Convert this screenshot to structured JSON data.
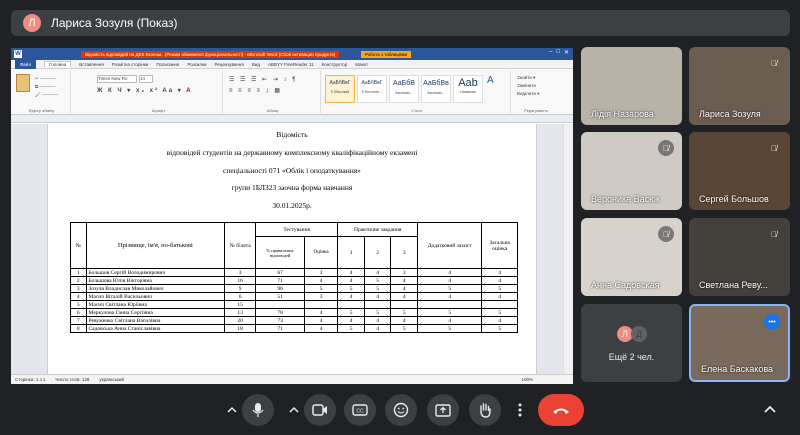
{
  "pinned": {
    "avatar_letter": "Л",
    "title": "Лариса Зозуля (Показ)"
  },
  "word": {
    "title": "Відомість відповідей на ДЕК Економ...(Режим обмеженої функціональності) - Microsoft Word (Сбой активации продукта)",
    "context_tab": "Робота з таблицями",
    "tabs": [
      "Файл",
      "Головна",
      "Вставлення",
      "Розмітка сторінки",
      "Посилання",
      "Розсилки",
      "Рецензування",
      "Вид",
      "ABBYY FineReader 11",
      "Конструктор",
      "Макет"
    ],
    "font_name": "Times New Ro",
    "font_size": "14",
    "styles": [
      {
        "preview": "АаБбВвГ",
        "name": "¶ Обычный"
      },
      {
        "preview": "АаБбВвГ",
        "name": "¶ Без инте..."
      },
      {
        "preview": "АаБбВ",
        "name": "Заголово..."
      },
      {
        "preview": "АаБбВв",
        "name": "Заголово..."
      },
      {
        "preview": "Aab",
        "name": "Название"
      }
    ],
    "group_labels": [
      "Буфер обміну",
      "Шрифт",
      "Абзац",
      "Стилі",
      "Редагування"
    ],
    "edit_items": [
      "Знайти ▾",
      "Замінити",
      "Виділити ▾"
    ],
    "status_left": "Сторінка: 1 з 1",
    "status_words": "Число слов: 128",
    "status_lang": "український",
    "zoom": "100%"
  },
  "doc": {
    "heading": "Відомість",
    "line2": "відповідей студентів на державному комплексному кваліфікаційному екзамені",
    "line3": "спеціальності 071 «Облік і оподаткування»",
    "line4": "групи 1БЛЗ23 заочна форма навчання",
    "line5": "30.01.2025р.",
    "table_headers": {
      "num": "№",
      "name": "Прізвище, ім'я, по-батькові",
      "ticket": "№ білета",
      "testing": "Тестування",
      "pct": "% правильних відповідей",
      "grade": "Оцінка",
      "practical": "Практичне завдання",
      "p1": "1",
      "p2": "2",
      "p3": "3",
      "extra": "Додатковий захист",
      "overall": "Загальна оцінка"
    },
    "rows": [
      {
        "n": "1",
        "name": "Большов Сергій Володимирович",
        "ticket": "3",
        "pct": "67",
        "grade": "3",
        "p1": "4",
        "p2": "4",
        "p3": "3",
        "extra": "4",
        "overall": "4"
      },
      {
        "n": "2",
        "name": "Большова Юлія Вікторівна",
        "ticket": "16",
        "pct": "71",
        "grade": "4",
        "p1": "4",
        "p2": "5",
        "p3": "4",
        "extra": "4",
        "overall": "4"
      },
      {
        "n": "3",
        "name": "Зозуля Владислав Миколайович",
        "ticket": "9",
        "pct": "96",
        "grade": "5",
        "p1": "5",
        "p2": "5",
        "p3": "4",
        "extra": "5",
        "overall": "5"
      },
      {
        "n": "4",
        "name": "Масич Віталій Васильович",
        "ticket": "6",
        "pct": "51",
        "grade": "3",
        "p1": "4",
        "p2": "4",
        "p3": "4",
        "extra": "4",
        "overall": "4"
      },
      {
        "n": "5",
        "name": "Масич Світлана Юріївна",
        "ticket": "15",
        "pct": "",
        "grade": "",
        "p1": "",
        "p2": "",
        "p3": "",
        "extra": "",
        "overall": ""
      },
      {
        "n": "6",
        "name": "Меркулова Ганна Сергіївна",
        "ticket": "13",
        "pct": "78",
        "grade": "4",
        "p1": "5",
        "p2": "5",
        "p3": "5",
        "extra": "5",
        "overall": "5"
      },
      {
        "n": "7",
        "name": "Ревуженко Світлана Василівна",
        "ticket": "20",
        "pct": "73",
        "grade": "4",
        "p1": "4",
        "p2": "4",
        "p3": "4",
        "extra": "4",
        "overall": "4"
      },
      {
        "n": "8",
        "name": "Садовська Анна Станіславівна",
        "ticket": "18",
        "pct": "71",
        "grade": "4",
        "p1": "5",
        "p2": "4",
        "p3": "5",
        "extra": "5",
        "overall": "5"
      }
    ]
  },
  "participants": [
    {
      "name": "Лідія Назарова",
      "muted": false,
      "bg": "#b9b2a8"
    },
    {
      "name": "Лариса Зозуля",
      "muted": true,
      "bg": "#6b5d4f"
    },
    {
      "name": "Вероника Васюк",
      "muted": true,
      "bg": "#cfcac4"
    },
    {
      "name": "Сергей Большов",
      "muted": true,
      "bg": "#5a4636"
    },
    {
      "name": "Анна Садовская",
      "muted": true,
      "bg": "#d7d2cc"
    },
    {
      "name": "Светлана Реву...",
      "muted": true,
      "bg": "#44403b"
    },
    {
      "name": "Ещё 2 чел.",
      "muted": false,
      "bg": "#3c4043"
    },
    {
      "name": "Елена Баскакова",
      "muted": false,
      "bg": "#7a6a5c"
    }
  ],
  "more_avatars": [
    "Л",
    "Д"
  ],
  "colors": {
    "accent": "#8ab4f8",
    "end_call": "#ea4335",
    "bg": "#202124",
    "surface": "#3c4043"
  }
}
